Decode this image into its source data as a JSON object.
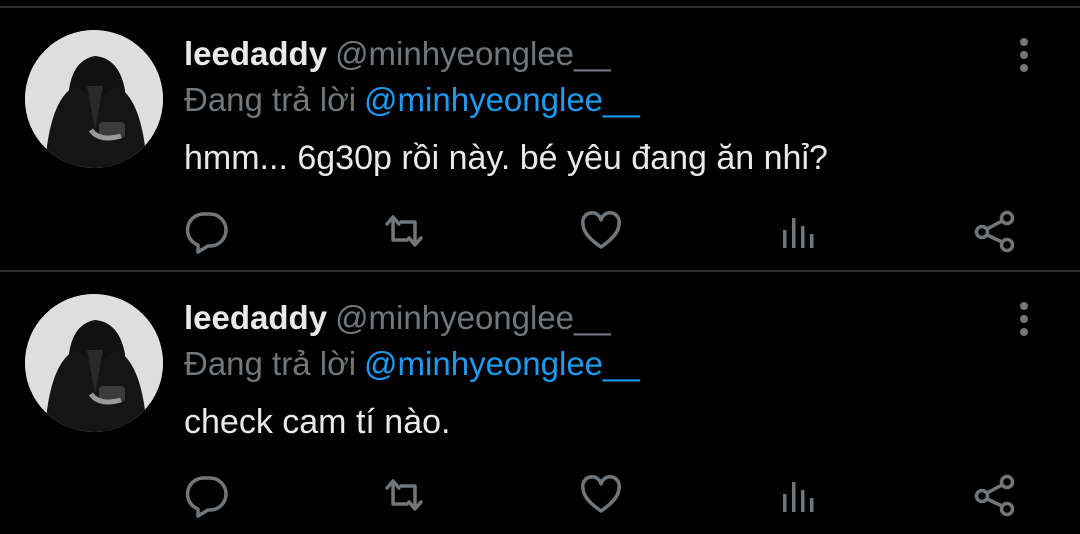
{
  "tweets": [
    {
      "display_name": "leedaddy",
      "handle": "@minhyeonglee__",
      "reply_prefix": "Đang trả lời",
      "reply_to": "@minhyeonglee__",
      "text": "hmm... 6g30p rồi này. bé yêu đang ăn nhỉ?"
    },
    {
      "display_name": "leedaddy",
      "handle": "@minhyeonglee__",
      "reply_prefix": "Đang trả lời",
      "reply_to": "@minhyeonglee__",
      "text": "check cam tí nào."
    }
  ],
  "icons": {
    "avatar": "avatar",
    "more": "more-vertical-icon",
    "reply": "reply-icon",
    "retweet": "retweet-icon",
    "like": "heart-icon",
    "stats": "analytics-icon",
    "share": "share-icon"
  },
  "colors": {
    "background": "#000000",
    "text": "#e7e9ea",
    "secondary": "#71767b",
    "mention": "#1d9bf0",
    "divider": "#2f3336"
  }
}
